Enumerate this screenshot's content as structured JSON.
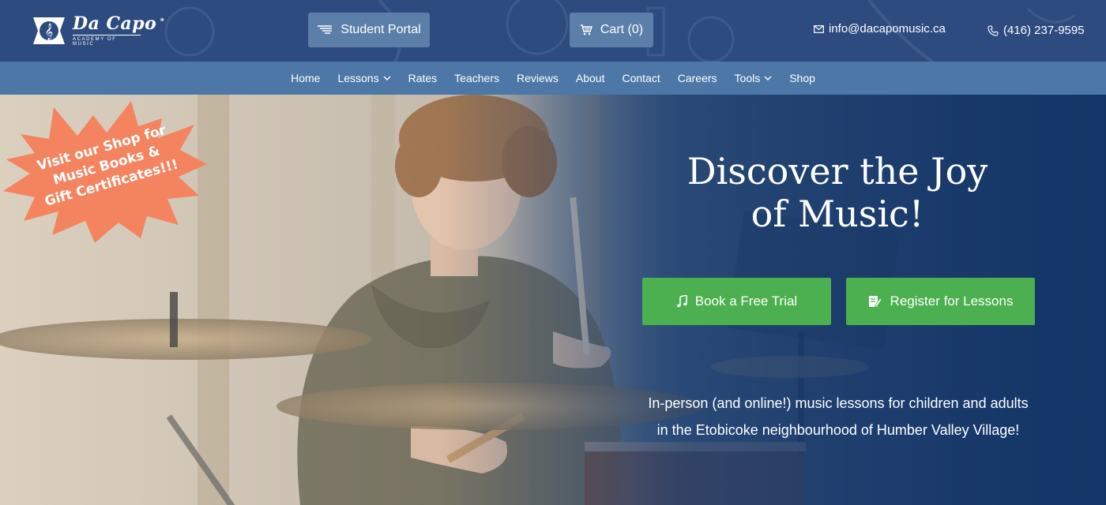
{
  "header": {
    "logo": {
      "name": "Da Capo",
      "star": "*",
      "tagline": "ACADEMY OF MUSIC"
    },
    "student_portal_label": "Student Portal",
    "cart_label": "Cart (0)",
    "email": "info@dacapomusic.ca",
    "phone": "(416) 237-9595"
  },
  "nav": {
    "items": [
      {
        "label": "Home",
        "has_dropdown": false
      },
      {
        "label": "Lessons",
        "has_dropdown": true
      },
      {
        "label": "Rates",
        "has_dropdown": false
      },
      {
        "label": "Teachers",
        "has_dropdown": false
      },
      {
        "label": "Reviews",
        "has_dropdown": false
      },
      {
        "label": "About",
        "has_dropdown": false
      },
      {
        "label": "Contact",
        "has_dropdown": false
      },
      {
        "label": "Careers",
        "has_dropdown": false
      },
      {
        "label": "Tools",
        "has_dropdown": true
      },
      {
        "label": "Shop",
        "has_dropdown": false
      }
    ]
  },
  "hero": {
    "promo_line1": "Visit our Shop for",
    "promo_line2": "Music Books &",
    "promo_line3": "Gift Certificates!!!",
    "title_line1": "Discover the Joy",
    "title_line2": "of Music!",
    "book_trial_label": "Book a Free Trial",
    "register_label": "Register for Lessons",
    "subtitle_line1": "In-person (and online!) music lessons for children and adults",
    "subtitle_line2": "in the Etobicoke neighbourhood of Humber Valley Village!"
  },
  "colors": {
    "topbar": "#2e4b7f",
    "nav": "#4d77a6",
    "top_button": "#5b7fa8",
    "cta_green": "#4caf50",
    "promo_orange": "#f4845f"
  },
  "icons": {
    "portal": "portal-lines-icon",
    "cart": "cart-icon",
    "email": "envelope-icon",
    "phone": "phone-icon",
    "trial": "music-note-icon",
    "register": "edit-form-icon",
    "dropdown": "chevron-down-icon"
  }
}
